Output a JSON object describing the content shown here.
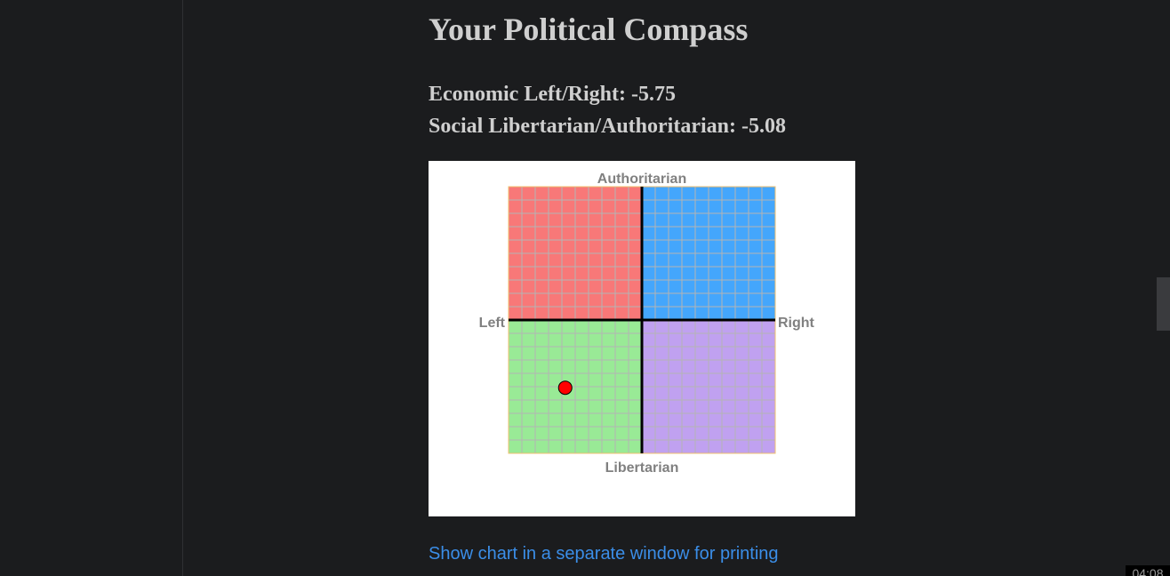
{
  "page": {
    "title": "Your Political Compass",
    "economic_line": "Economic Left/Right: -5.75",
    "social_line": "Social Libertarian/Authoritarian: -5.08",
    "print_link": "Show chart in a separate window for printing"
  },
  "clock": "04:08",
  "colors": {
    "auth_left": "#f87878",
    "auth_right": "#44a6fc",
    "lib_left": "#99ea96",
    "lib_right": "#c0a1f0",
    "grid_line": "#b4b4b4",
    "axis": "#000000",
    "marker": "#ff0000",
    "link": "#3b8ee8"
  },
  "chart_data": {
    "type": "scatter",
    "title": "",
    "labels": {
      "top": "Authoritarian",
      "bottom": "Libertarian",
      "left": "Left",
      "right": "Right"
    },
    "xlim": [
      -10,
      10
    ],
    "ylim": [
      -10,
      10
    ],
    "grid": true,
    "grid_step": 1,
    "points": [
      {
        "x": -5.75,
        "y": -5.08
      }
    ]
  }
}
